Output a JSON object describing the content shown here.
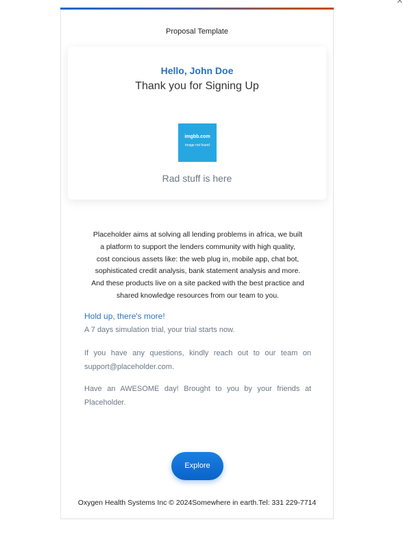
{
  "window": {
    "close_glyph": "×"
  },
  "email": {
    "template_title": "Proposal Template",
    "accent_colors": [
      "#1f66c8",
      "#c8480f"
    ],
    "card": {
      "greeting": "Hello, John Doe",
      "headline": "Thank you for Signing Up",
      "image_text_main": "imgbb.com",
      "image_text_sub": "image not found",
      "tagline": "Rad stuff is here"
    },
    "intro_lines": [
      "Placeholder aims at solving all lending problems in africa, we built",
      "a platform to support the lenders community with high quality,",
      "cost concious assets like: the web plug in, mobile app, chat bot,",
      "sophisticated credit analysis, bank statement analysis and more.",
      "And these products live on a site packed with the best practice and",
      "shared knowledge resources from our team to you."
    ],
    "hold_up": "Hold up, there's more!",
    "trial_text": "A 7 days simulation trial, your trial starts now.",
    "questions_text": "If you have any questions, kindly reach out to our team on support@placeholder.com.",
    "awesome_text": "Have an AWESOME day! Brought to you by your friends at Placeholder.",
    "button_label": "Explore",
    "footer": "Oxygen Health Systems Inc © 2024Somewhere in earth.Tel: 331 229-7714"
  }
}
